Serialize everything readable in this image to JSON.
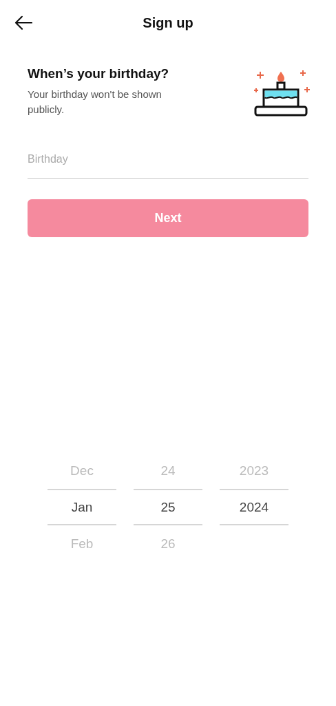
{
  "header": {
    "title": "Sign up"
  },
  "heading": "When’s your birthday?",
  "subtitle": "Your birthday won't be shown publicly.",
  "birthday_field": {
    "placeholder": "Birthday"
  },
  "next_button": {
    "label": "Next",
    "disabled": true
  },
  "date_picker": {
    "columns": [
      {
        "items": [
          {
            "label": "Dec",
            "selected": false
          },
          {
            "label": "Jan",
            "selected": true
          },
          {
            "label": "Feb",
            "selected": false
          }
        ]
      },
      {
        "items": [
          {
            "label": "24",
            "selected": false
          },
          {
            "label": "25",
            "selected": true
          },
          {
            "label": "26",
            "selected": false
          }
        ]
      },
      {
        "items": [
          {
            "label": "2023",
            "selected": false
          },
          {
            "label": "2024",
            "selected": true
          }
        ]
      }
    ]
  }
}
